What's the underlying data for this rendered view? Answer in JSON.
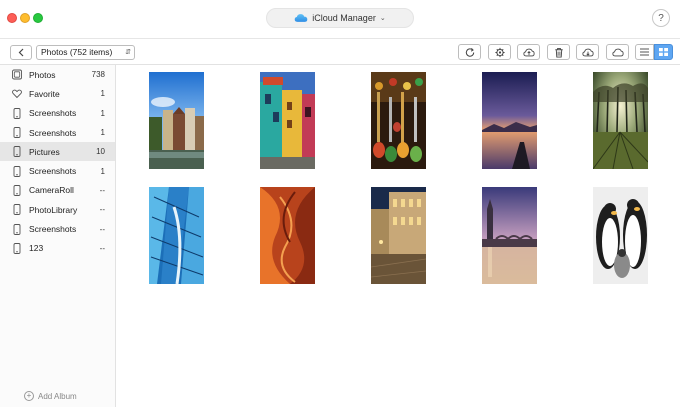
{
  "window": {
    "title": "iCloud Manager",
    "help_label": "?"
  },
  "toolbar": {
    "back_label": "<",
    "album_select_value": "Photos (752 items)",
    "buttons": [
      {
        "name": "refresh-icon"
      },
      {
        "name": "settings-icon"
      },
      {
        "name": "upload-icon"
      },
      {
        "name": "delete-icon"
      },
      {
        "name": "download-icon"
      },
      {
        "name": "cloud-icon"
      }
    ],
    "view_modes": [
      "list-view-icon",
      "grid-view-icon"
    ],
    "accent_color": "#5ea6f2"
  },
  "sidebar": {
    "items": [
      {
        "label": "Photos",
        "count": "738",
        "icon": "photos-icon"
      },
      {
        "label": "Favorite",
        "count": "1",
        "icon": "heart-icon"
      },
      {
        "label": "Screenshots",
        "count": "1",
        "icon": "phone-icon"
      },
      {
        "label": "Screenshots",
        "count": "1",
        "icon": "phone-icon"
      },
      {
        "label": "Pictures",
        "count": "10",
        "icon": "phone-icon",
        "selected": true
      },
      {
        "label": "Screenshots",
        "count": "1",
        "icon": "phone-icon"
      },
      {
        "label": "CameraRoll",
        "count": "--",
        "icon": "phone-icon"
      },
      {
        "label": "PhotoLibrary",
        "count": "--",
        "icon": "phone-icon"
      },
      {
        "label": "Screenshots",
        "count": "--",
        "icon": "phone-icon"
      },
      {
        "label": "123",
        "count": "--",
        "icon": "phone-icon"
      }
    ],
    "add_album_label": "Add Album"
  },
  "photos": [
    {
      "name": "amsterdam-canal-houses"
    },
    {
      "name": "colorful-street-houses"
    },
    {
      "name": "hookah-pipes"
    },
    {
      "name": "lake-sunset-pier"
    },
    {
      "name": "park-trees-sunlight"
    },
    {
      "name": "blue-glass-architecture"
    },
    {
      "name": "antelope-canyon"
    },
    {
      "name": "european-square-night"
    },
    {
      "name": "london-big-ben"
    },
    {
      "name": "penguins"
    }
  ]
}
